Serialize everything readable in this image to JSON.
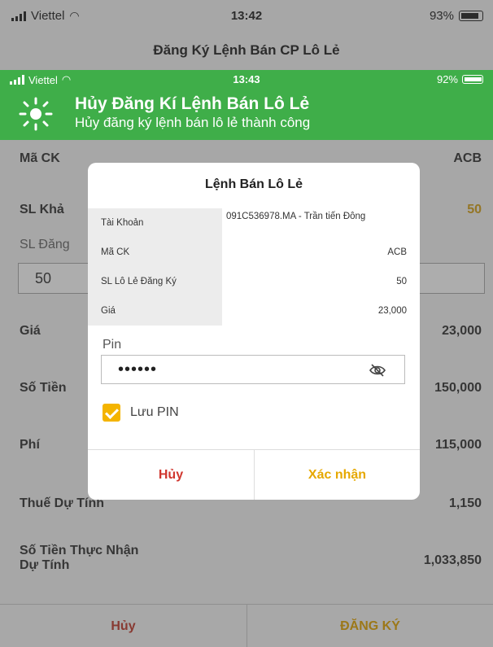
{
  "status_bar": {
    "carrier": "Viettel",
    "time": "13:42",
    "battery": "93%"
  },
  "nav": {
    "title": "Đăng Ký Lệnh Bán CP Lô Lẻ"
  },
  "form": {
    "ma_ck": {
      "label": "Mã CK",
      "value": "ACB"
    },
    "sl_kha": {
      "label": "SL Khả",
      "value": "50"
    },
    "sl_dang": {
      "label": "SL Đăng",
      "input_value": "50"
    },
    "gia": {
      "label": "Giá",
      "value": "23,000"
    },
    "so_tien": {
      "label": "Số Tiền",
      "value": "150,000"
    },
    "phi": {
      "label": "Phí",
      "value": "115,000"
    },
    "thue": {
      "label": "Thuế Dự Tính",
      "value": "1,150"
    },
    "thuc_nhan": {
      "label_line1": "Số Tiền Thực Nhận",
      "label_line2": "Dự Tính",
      "value": "1,033,850"
    }
  },
  "footer": {
    "cancel": "Hủy",
    "register": "ĐĂNG KÝ"
  },
  "banner": {
    "status": {
      "carrier": "Viettel",
      "time": "13:43",
      "battery": "92%"
    },
    "title": "Hủy Đăng Kí Lệnh Bán Lô Lẻ",
    "message": "Hủy đăng ký lệnh bán lô lẻ thành công",
    "color": "#3fae49"
  },
  "modal": {
    "title": "Lệnh Bán Lô Lẻ",
    "rows": [
      {
        "key": "Tài Khoản",
        "value": "091C536978.MA - Trần tiến Đông"
      },
      {
        "key": "Mã CK",
        "value": "ACB"
      },
      {
        "key": "SL Lô Lẻ Đăng Ký",
        "value": "50"
      },
      {
        "key": "Giá",
        "value": "23,000"
      }
    ],
    "pin_label": "Pin",
    "pin_value": "••••••",
    "save_pin_label": "Lưu PIN",
    "save_pin_checked": true,
    "cancel": "Hủy",
    "confirm": "Xác nhận",
    "accent": "#f4b400"
  }
}
